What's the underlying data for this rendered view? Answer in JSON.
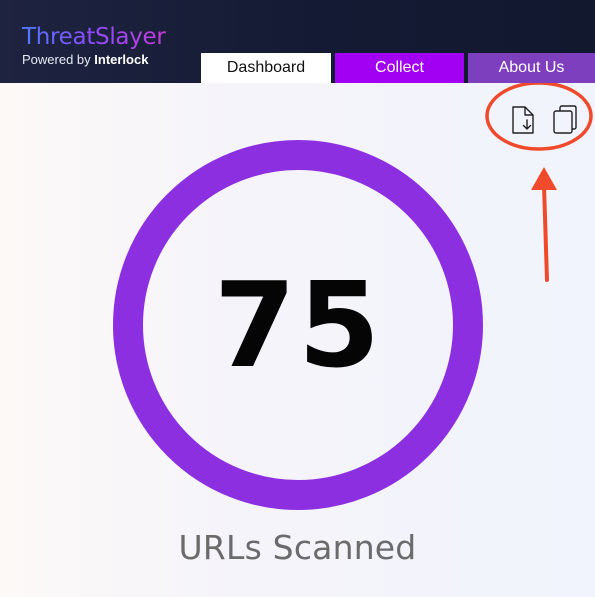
{
  "brand": {
    "title": "ThreatSlayer",
    "subtitle_prefix": "Powered by ",
    "subtitle_strong": "Interlock"
  },
  "nav": {
    "tabs": [
      {
        "label": "Dashboard",
        "active": true
      },
      {
        "label": "Collect",
        "active": false
      },
      {
        "label": "About Us",
        "active": false
      }
    ]
  },
  "toolbar": {
    "icons": [
      "download-file-icon",
      "copy-icon"
    ]
  },
  "stats": {
    "count": "75",
    "label": "URLs Scanned"
  },
  "colors": {
    "header_bg": "#141a33",
    "ring": "#8c2fe0",
    "collect_tab": "#a100f2",
    "about_tab": "#7e3fbf",
    "annotation": "#ef4a2b"
  }
}
